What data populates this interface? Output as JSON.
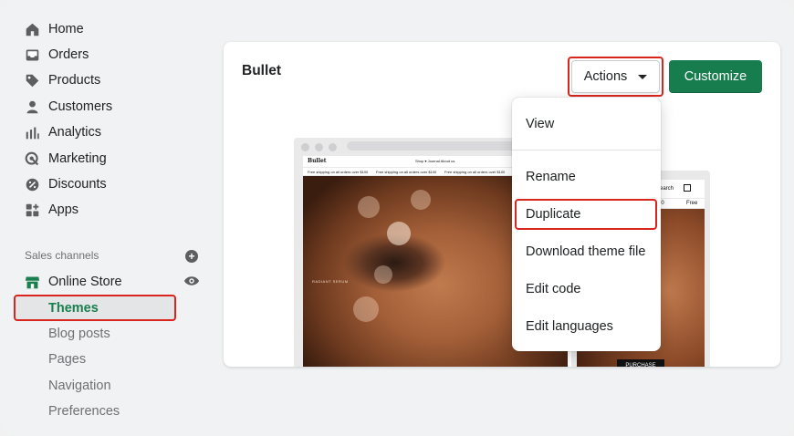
{
  "sidebar": {
    "items": [
      {
        "label": "Home",
        "icon": "home-icon"
      },
      {
        "label": "Orders",
        "icon": "inbox-icon"
      },
      {
        "label": "Products",
        "icon": "tag-icon"
      },
      {
        "label": "Customers",
        "icon": "person-icon"
      },
      {
        "label": "Analytics",
        "icon": "bar-chart-icon"
      },
      {
        "label": "Marketing",
        "icon": "target-icon"
      },
      {
        "label": "Discounts",
        "icon": "discount-icon"
      },
      {
        "label": "Apps",
        "icon": "apps-icon"
      }
    ],
    "sales_channels_label": "Sales channels",
    "online_store_label": "Online Store",
    "sub_items": [
      {
        "label": "Themes",
        "active": true
      },
      {
        "label": "Blog posts"
      },
      {
        "label": "Pages"
      },
      {
        "label": "Navigation"
      },
      {
        "label": "Preferences"
      }
    ]
  },
  "theme_card": {
    "title": "Bullet",
    "actions_label": "Actions",
    "customize_label": "Customize"
  },
  "preview": {
    "logo": "Bullet",
    "menu": "Shop ▾    Journal    About us",
    "shipping": "Free shipping on all orders over $100",
    "hero_text": "RADIANT SERUM",
    "mobile_search": "Search",
    "mobile_price": "00",
    "mobile_free": "Free",
    "purchase": "PURCHASE"
  },
  "dropdown": {
    "items": [
      "View",
      "Rename",
      "Duplicate",
      "Download theme file",
      "Edit code",
      "Edit languages"
    ]
  },
  "colors": {
    "accent_green": "#177c4e",
    "highlight_red": "#d9251d",
    "background": "#f1f2f3"
  }
}
